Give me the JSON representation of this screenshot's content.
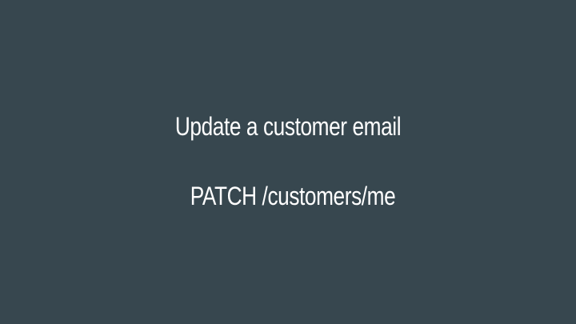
{
  "slide": {
    "title": "Update a customer email",
    "endpoint": "PATCH /customers/me"
  },
  "colors": {
    "background": "#37474f",
    "text": "#ffffff"
  }
}
